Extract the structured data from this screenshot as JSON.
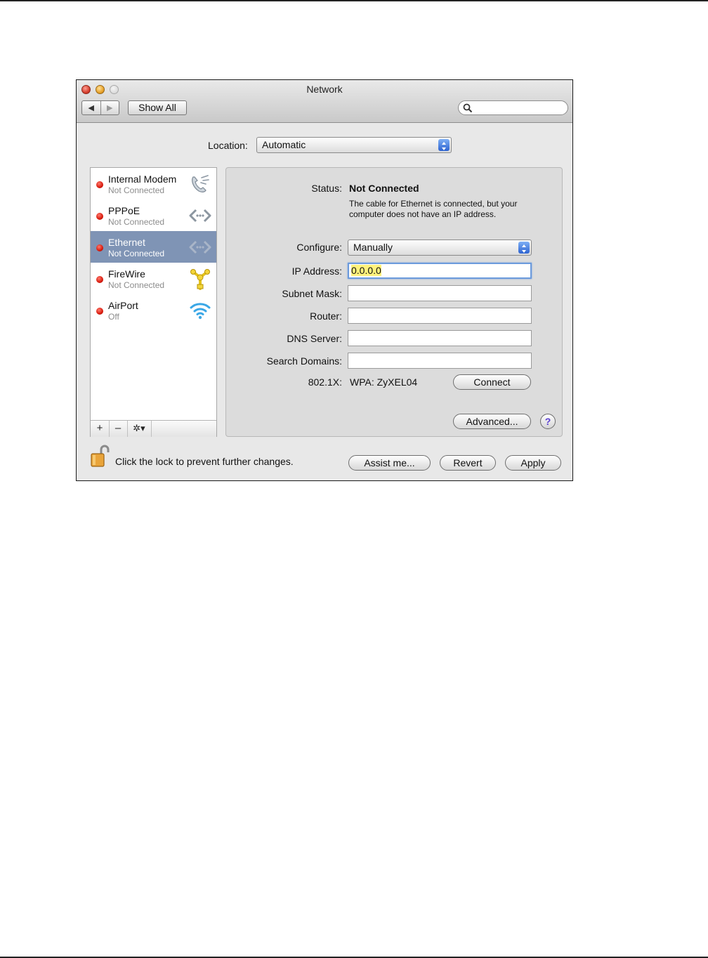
{
  "window": {
    "title": "Network"
  },
  "toolbar": {
    "back_glyph": "◀",
    "forward_glyph": "▶",
    "show_all_label": "Show All",
    "search_value": ""
  },
  "location": {
    "label": "Location:",
    "value": "Automatic"
  },
  "services": [
    {
      "name": "Internal Modem",
      "status": "Not Connected",
      "icon": "phone-icon",
      "selected": false
    },
    {
      "name": "PPPoE",
      "status": "Not Connected",
      "icon": "ethernet-icon",
      "selected": false
    },
    {
      "name": "Ethernet",
      "status": "Not Connected",
      "icon": "ethernet-icon",
      "selected": true
    },
    {
      "name": "FireWire",
      "status": "Not Connected",
      "icon": "firewire-icon",
      "selected": false
    },
    {
      "name": "AirPort",
      "status": "Off",
      "icon": "wifi-icon",
      "selected": false
    }
  ],
  "sidebar_toolbar": {
    "add": "+",
    "remove": "–",
    "gear": "✲▾"
  },
  "detail": {
    "status_label": "Status:",
    "status_value": "Not Connected",
    "status_message": "The cable for Ethernet is connected, but your computer does not have an IP address.",
    "configure_label": "Configure:",
    "configure_value": "Manually",
    "ip_label": "IP Address:",
    "ip_value": "0.0.0.0",
    "subnet_label": "Subnet Mask:",
    "subnet_value": "",
    "router_label": "Router:",
    "router_value": "",
    "dns_label": "DNS Server:",
    "dns_value": "",
    "search_domains_label": "Search Domains:",
    "search_domains_value": "",
    "dot1x_label": "802.1X:",
    "dot1x_value": "WPA: ZyXEL04",
    "connect_label": "Connect",
    "advanced_label": "Advanced...",
    "help_glyph": "?"
  },
  "footer": {
    "lock_text": "Click the lock to prevent further changes.",
    "assist_label": "Assist me...",
    "revert_label": "Revert",
    "apply_label": "Apply"
  },
  "colors": {
    "selection": "#7f94b5",
    "status_dot": "#d81a0c",
    "popup_arrows": "#2d63d0",
    "ip_highlight": "#fff27c"
  }
}
